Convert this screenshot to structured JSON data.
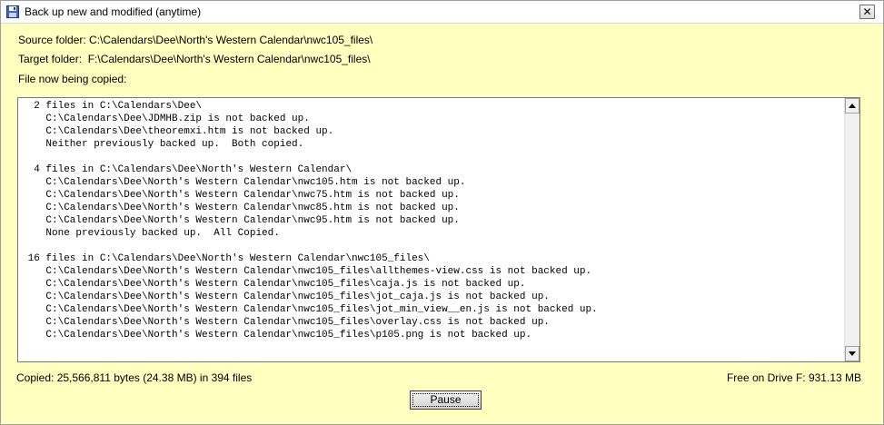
{
  "window": {
    "title": "Back up new and modified (anytime)",
    "icon": "floppy-disk-icon",
    "close_label": "✕"
  },
  "info": {
    "source_folder": "Source folder: C:\\Calendars\\Dee\\North's Western Calendar\\nwc105_files\\",
    "target_folder": "Target folder:  F:\\Calendars\\Dee\\North's Western Calendar\\nwc105_files\\",
    "file_now_copying": "File now being copied:"
  },
  "log": {
    "lines": [
      "  2 files in C:\\Calendars\\Dee\\",
      "    C:\\Calendars\\Dee\\JDMHB.zip is not backed up.",
      "    C:\\Calendars\\Dee\\theoremxi.htm is not backed up.",
      "    Neither previously backed up.  Both copied.",
      "",
      "  4 files in C:\\Calendars\\Dee\\North's Western Calendar\\",
      "    C:\\Calendars\\Dee\\North's Western Calendar\\nwc105.htm is not backed up.",
      "    C:\\Calendars\\Dee\\North's Western Calendar\\nwc75.htm is not backed up.",
      "    C:\\Calendars\\Dee\\North's Western Calendar\\nwc85.htm is not backed up.",
      "    C:\\Calendars\\Dee\\North's Western Calendar\\nwc95.htm is not backed up.",
      "    None previously backed up.  All Copied.",
      "",
      " 16 files in C:\\Calendars\\Dee\\North's Western Calendar\\nwc105_files\\",
      "    C:\\Calendars\\Dee\\North's Western Calendar\\nwc105_files\\allthemes-view.css is not backed up.",
      "    C:\\Calendars\\Dee\\North's Western Calendar\\nwc105_files\\caja.js is not backed up.",
      "    C:\\Calendars\\Dee\\North's Western Calendar\\nwc105_files\\jot_caja.js is not backed up.",
      "    C:\\Calendars\\Dee\\North's Western Calendar\\nwc105_files\\jot_min_view__en.js is not backed up.",
      "    C:\\Calendars\\Dee\\North's Western Calendar\\nwc105_files\\overlay.css is not backed up.",
      "    C:\\Calendars\\Dee\\North's Western Calendar\\nwc105_files\\p105.png is not backed up."
    ]
  },
  "status": {
    "copied": "Copied: 25,566,811 bytes (24.38 MB) in 394 files",
    "free_space": "Free on Drive F: 931.13 MB"
  },
  "buttons": {
    "pause_label": "Pause"
  },
  "colors": {
    "background": "#ffffc0",
    "log_background": "#ffffff"
  }
}
